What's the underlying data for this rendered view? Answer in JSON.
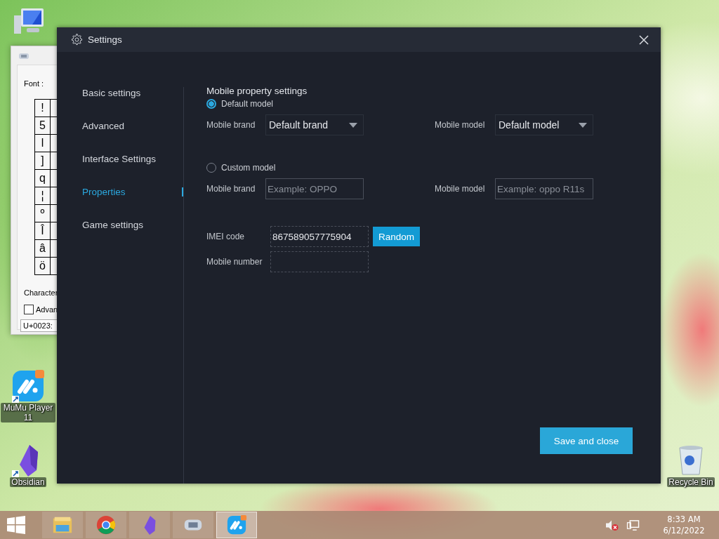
{
  "desktop": {
    "icons": [
      {
        "kind": "computer"
      },
      {
        "kind": "mumu",
        "label": "MuMu Player 11"
      },
      {
        "kind": "obsidian",
        "label": "Obsidian"
      },
      {
        "kind": "bin",
        "label": "Recycle Bin"
      }
    ]
  },
  "character_map": {
    "font_label": "Font :",
    "characters": [
      "!",
      "5",
      "l",
      "]",
      "q",
      "¦",
      "º",
      "Î",
      "â",
      "ö"
    ],
    "character_label": "Character",
    "advanced": {
      "label": "Advan",
      "checked": false
    },
    "code": "U+0023:"
  },
  "settings": {
    "title": "Settings",
    "nav": [
      {
        "label": "Basic settings",
        "selected": false
      },
      {
        "label": "Advanced",
        "selected": false
      },
      {
        "label": "Interface Settings",
        "selected": false
      },
      {
        "label": "Properties",
        "selected": true
      },
      {
        "label": "Game settings",
        "selected": false
      }
    ],
    "section_title": "Mobile property settings",
    "models": [
      {
        "label": "Default model",
        "selected": true,
        "fields": [
          {
            "label": "Mobile brand",
            "kind": "dropdown",
            "value": "Default brand"
          },
          {
            "label": "Mobile model",
            "kind": "dropdown",
            "value": "Default model"
          }
        ]
      },
      {
        "label": "Custom model",
        "selected": false,
        "fields": [
          {
            "label": "Mobile brand",
            "kind": "input",
            "placeholder": "Example: OPPO"
          },
          {
            "label": "Mobile model",
            "kind": "input",
            "placeholder": "Example: oppo R11s"
          }
        ]
      }
    ],
    "imei": {
      "label": "IMEI code",
      "value": "867589057775904",
      "button": "Random"
    },
    "mobile_number": {
      "label": "Mobile number"
    },
    "save_button": "Save and close"
  },
  "taskbar": {
    "apps": [
      {
        "kind": "explorer",
        "active": false
      },
      {
        "kind": "chrome",
        "active": false
      },
      {
        "kind": "obsidian",
        "active": false
      },
      {
        "kind": "charmap",
        "active": false
      },
      {
        "kind": "mumu",
        "active": true
      }
    ],
    "time": "8:33 AM",
    "date": "6/12/2022"
  }
}
